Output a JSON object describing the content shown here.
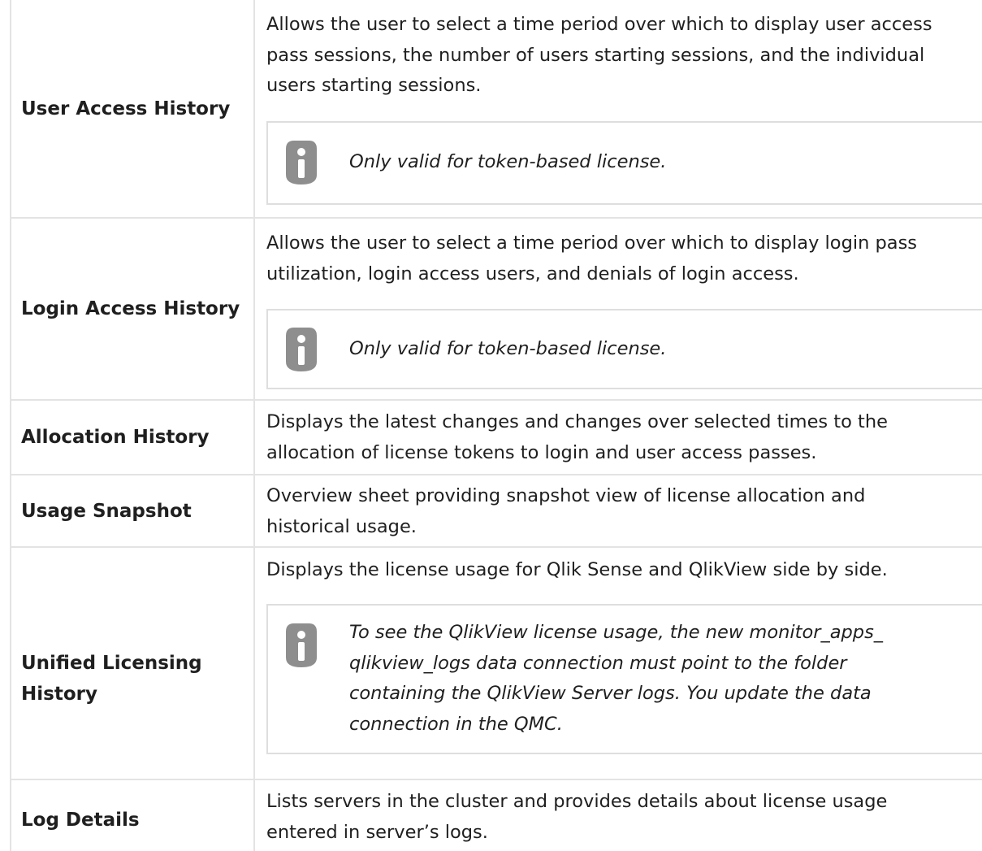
{
  "rows": [
    {
      "name": "User Access History",
      "description": "Allows the user to select a time period over which to display user access\npass sessions, the number of users starting sessions, and the individual\nusers starting sessions.",
      "note": "Only valid for token-based license.",
      "note_icon": "info-icon"
    },
    {
      "name": "Login Access History",
      "description": "Allows the user to select a time period over which to display login pass\nutilization, login access users, and denials of login access.",
      "note": "Only valid for token-based license.",
      "note_icon": "info-icon"
    },
    {
      "name": "Allocation History",
      "description": "Displays the latest changes and changes over selected times to the\nallocation of license tokens to login and user access passes."
    },
    {
      "name": "Usage Snapshot",
      "description": "Overview sheet providing snapshot view of license allocation and\nhistorical usage."
    },
    {
      "name": "Unified Licensing\nHistory",
      "description": "Displays the license usage for Qlik Sense and QlikView side by side.",
      "note": "To see the QlikView license usage, the new monitor_apps_\nqlikview_logs data connection must point to the folder\ncontaining the QlikView Server logs. You update the data\nconnection in the QMC.",
      "note_icon": "info-icon"
    },
    {
      "name": "Log Details",
      "description": "Lists servers in the cluster and provides details about license usage\nentered in server’s logs."
    }
  ],
  "colors": {
    "border": "#e3e3e3",
    "note_border": "#dedede",
    "icon": "#8e8e8e",
    "text": "#1f1f1f"
  }
}
